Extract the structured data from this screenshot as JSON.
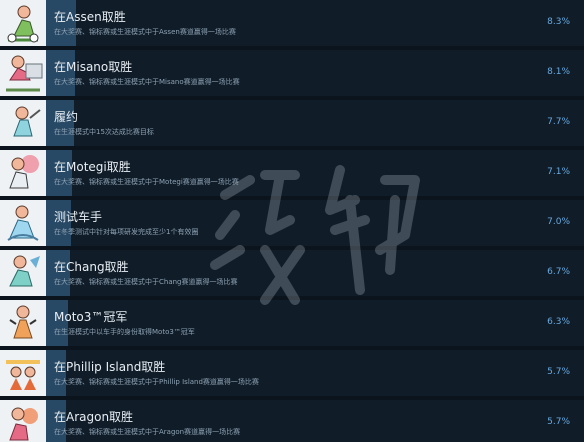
{
  "achievements": [
    {
      "title": "在Assen取胜",
      "description": "在大奖赛、锦标赛或生涯模式中于Assen赛道赢得一场比赛",
      "percent": "8.3%",
      "icon": "rider-cartoon-icon",
      "progress": 0.083
    },
    {
      "title": "在Misano取胜",
      "description": "在大奖赛、锦标赛或生涯模式中于Misano赛道赢得一场比赛",
      "percent": "8.1%",
      "icon": "rider-cartoon-icon",
      "progress": 0.081
    },
    {
      "title": "履约",
      "description": "在生涯模式中15次达成比赛目标",
      "percent": "7.7%",
      "icon": "rider-cartoon-icon",
      "progress": 0.077
    },
    {
      "title": "在Motegi取胜",
      "description": "在大奖赛、锦标赛或生涯模式中于Motegi赛道赢得一场比赛",
      "percent": "7.1%",
      "icon": "rider-cartoon-icon",
      "progress": 0.071
    },
    {
      "title": "测试车手",
      "description": "在冬季测试中针对每项研发完成至少1个有效圈",
      "percent": "7.0%",
      "icon": "rider-cartoon-icon",
      "progress": 0.07
    },
    {
      "title": "在Chang取胜",
      "description": "在大奖赛、锦标赛或生涯模式中于Chang赛道赢得一场比赛",
      "percent": "6.7%",
      "icon": "rider-cartoon-icon",
      "progress": 0.067
    },
    {
      "title": "Moto3™冠军",
      "description": "在生涯模式中以车手的身份取得Moto3™冠军",
      "percent": "6.3%",
      "icon": "rider-cartoon-icon",
      "progress": 0.063
    },
    {
      "title": "在Phillip Island取胜",
      "description": "在大奖赛、锦标赛或生涯模式中于Phillip Island赛道赢得一场比赛",
      "percent": "5.7%",
      "icon": "rider-cartoon-icon",
      "progress": 0.057
    },
    {
      "title": "在Aragon取胜",
      "description": "在大奖赛、锦标赛或生涯模式中于Aragon赛道赢得一场比赛",
      "percent": "5.7%",
      "icon": "rider-cartoon-icon",
      "progress": 0.057
    }
  ],
  "watermark": "游侠网",
  "colors": {
    "accent": "#67a9e0",
    "progress": "#2d5170",
    "row": "#101d29"
  }
}
